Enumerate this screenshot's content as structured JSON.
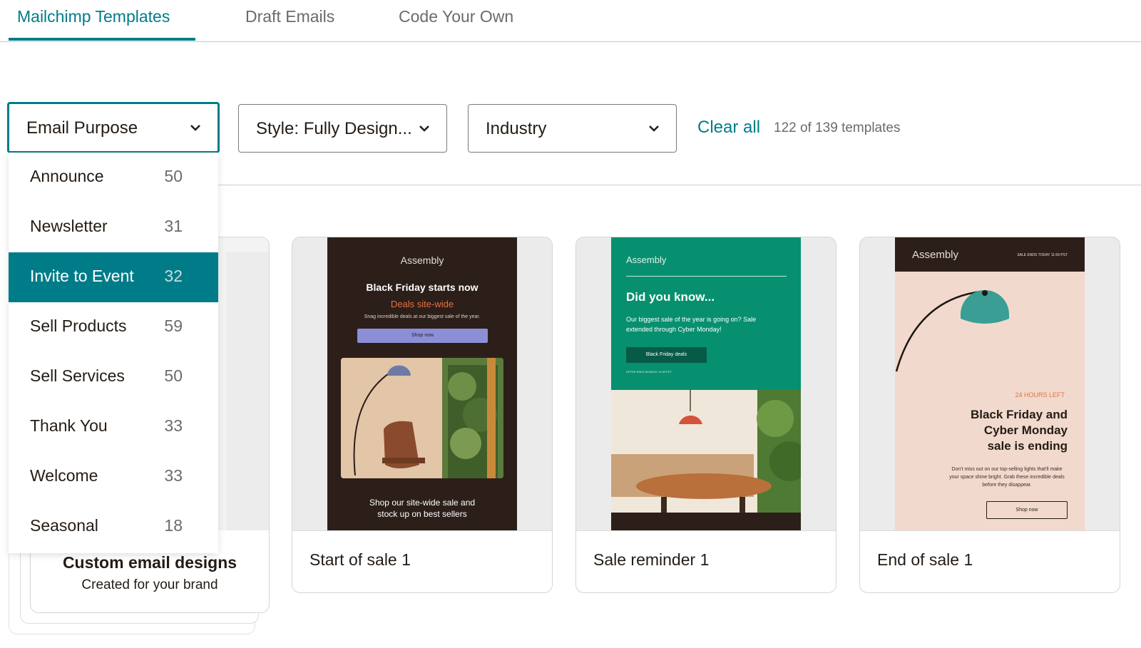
{
  "tabs": [
    {
      "label": "Mailchimp Templates",
      "active": true
    },
    {
      "label": "Draft Emails",
      "active": false
    },
    {
      "label": "Code Your Own",
      "active": false
    }
  ],
  "filters": {
    "email_purpose": "Email Purpose",
    "style": "Style: Fully Design...",
    "industry": "Industry",
    "clear_all": "Clear all",
    "count": "122 of 139 templates"
  },
  "dropdown": {
    "items": [
      {
        "label": "Announce",
        "count": "50"
      },
      {
        "label": "Newsletter",
        "count": "31"
      },
      {
        "label": "Invite to Event",
        "count": "32",
        "selected": true
      },
      {
        "label": "Sell Products",
        "count": "59"
      },
      {
        "label": "Sell Services",
        "count": "50"
      },
      {
        "label": "Thank You",
        "count": "33"
      },
      {
        "label": "Welcome",
        "count": "33"
      },
      {
        "label": "Seasonal",
        "count": "18"
      }
    ]
  },
  "custom": {
    "title": "Custom email designs",
    "subtitle": "Created for your brand"
  },
  "cards": [
    {
      "title": "Start of sale 1",
      "email": {
        "brand": "Assembly",
        "headline": "Black Friday starts now",
        "subhead": "Deals site-wide",
        "tiny": "Snag incredible deals at our biggest sale of the year.",
        "button": "Shop now",
        "footer_line1": "Shop our site-wide sale and",
        "footer_line2": "stock up on best sellers"
      }
    },
    {
      "title": "Sale reminder 1",
      "email": {
        "brand": "Assembly",
        "headline": "Did you know...",
        "body": "Our biggest sale of the year is going on? Sale extended through Cyber Monday!",
        "button": "Black Friday deals",
        "tiny": "OFFER ENDS MONDAY 11:59 PST"
      }
    },
    {
      "title": "End of sale 1",
      "email": {
        "brand": "Assembly",
        "tiny": "SALE ENDS TODAY 11:59 PST",
        "label": "24 HOURS LEFT",
        "headline_1": "Black Friday and",
        "headline_2": "Cyber Monday",
        "headline_3": "sale is ending",
        "body": "Don't miss out on our top-selling lights that'll make your space shine bright. Grab these incredible deals before they disappear.",
        "button": "Shop now"
      }
    }
  ],
  "colors": {
    "accent": "#007c89",
    "email1_bg": "#2c1f1a",
    "email2_green": "#07906f",
    "email3_pink": "#f1d9cd",
    "orange": "#e8703f"
  }
}
